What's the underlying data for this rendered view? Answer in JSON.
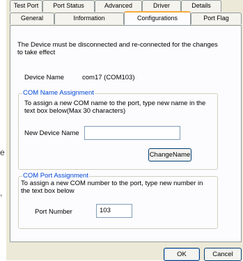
{
  "tabs_row1": [
    "Test Port",
    "Port Status",
    "Advanced",
    "Driver",
    "Details"
  ],
  "tabs_row2": [
    "General",
    "Information",
    "Configurations",
    "Port Flag"
  ],
  "notice": "The Device must be disconnected and re-connected for the changes to take effect",
  "device_name_label": "Device Name",
  "device_name_value": "com17 (COM103)",
  "com_name_group": {
    "title": "COM Name Assignment",
    "description": "To assign a new COM name to the port, type new name in the text box below(Max 30 characters)",
    "field_label": "New Device Name",
    "field_value": "",
    "button_label": "ChangeName"
  },
  "com_port_group": {
    "title": "COM Port Assignment",
    "description": "To assign a new COM number to the port, type new number in the text box below",
    "field_label": "Port Number",
    "field_value": "103"
  },
  "footer": {
    "ok_label": "OK",
    "cancel_label": "Cancel"
  },
  "edge_chars": [
    "e",
    ","
  ]
}
